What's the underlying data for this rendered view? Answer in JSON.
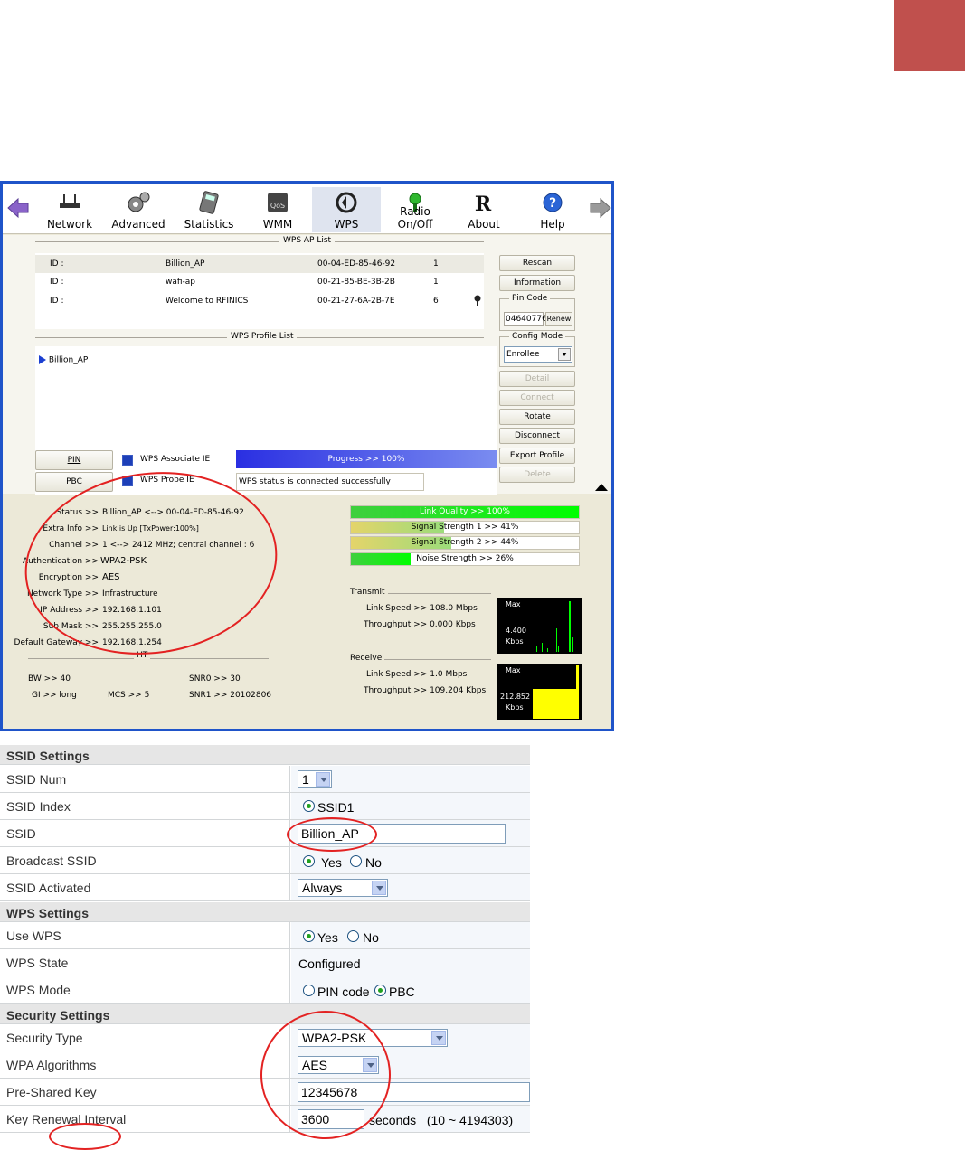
{
  "colors": {
    "corner_block": "#c0504d",
    "window_border": "#1f54c9",
    "annotation": "#e32222"
  },
  "toolbar": {
    "items": [
      {
        "label": "Network",
        "icon": "router-icon"
      },
      {
        "label": "Advanced",
        "icon": "gears-icon"
      },
      {
        "label": "Statistics",
        "icon": "calculator-icon"
      },
      {
        "label": "WMM",
        "icon": "qos-icon"
      },
      {
        "label": "WPS",
        "icon": "wps-icon"
      },
      {
        "label": "Radio On/Off",
        "icon": "radio-icon"
      },
      {
        "label": "About",
        "icon": "about-icon"
      },
      {
        "label": "Help",
        "icon": "help-icon"
      }
    ]
  },
  "wps_ap_list": {
    "title": "WPS AP List",
    "rows": [
      {
        "id_label": "ID :",
        "name": "Billion_AP",
        "mac": "00-04-ED-85-46-92",
        "channel": "1",
        "locked": false
      },
      {
        "id_label": "ID :",
        "name": "wafi-ap",
        "mac": "00-21-85-BE-3B-2B",
        "channel": "1",
        "locked": false
      },
      {
        "id_label": "ID :",
        "name": "Welcome to RFINICS",
        "mac": "00-21-27-6A-2B-7E",
        "channel": "6",
        "locked": true
      }
    ]
  },
  "wps_profile_list": {
    "title": "WPS Profile List",
    "items": [
      "Billion_AP"
    ]
  },
  "right_buttons": {
    "rescan": "Rescan",
    "information": "Information",
    "pin_code_title": "Pin Code",
    "pin_code": "04640776",
    "renew": "Renew",
    "config_mode_title": "Config Mode",
    "config_mode": "Enrollee",
    "detail": "Detail",
    "connect": "Connect",
    "rotate": "Rotate",
    "disconnect": "Disconnect",
    "export_profile": "Export Profile",
    "delete": "Delete"
  },
  "bottom_buttons": {
    "pin": "PIN",
    "pbc": "PBC",
    "associate_ie": "WPS Associate IE",
    "probe_ie": "WPS Probe IE"
  },
  "progress": {
    "text": "Progress >> 100%",
    "value": 1.0
  },
  "wps_status": "WPS status is connected successfully",
  "status": {
    "status": {
      "k": "Status >>",
      "v": "Billion_AP <--> 00-04-ED-85-46-92"
    },
    "extra_info": {
      "k": "Extra Info >>",
      "v": "Link is Up [TxPower:100%]"
    },
    "channel": {
      "k": "Channel >>",
      "v": "1 <--> 2412 MHz; central channel : 6"
    },
    "authentication": {
      "k": "Authentication >>",
      "v": "WPA2-PSK"
    },
    "encryption": {
      "k": "Encryption >>",
      "v": "AES"
    },
    "network_type": {
      "k": "Network Type >>",
      "v": "Infrastructure"
    },
    "ip_address": {
      "k": "IP Address >>",
      "v": "192.168.1.101"
    },
    "sub_mask": {
      "k": "Sub Mask >>",
      "v": "255.255.255.0"
    },
    "gateway": {
      "k": "Default Gateway >>",
      "v": "192.168.1.254"
    }
  },
  "ht": {
    "title": "HT",
    "bw": "BW >> 40",
    "gi": "GI >> long",
    "mcs": "MCS >> 5",
    "snr0": "SNR0 >> 30",
    "snr1": "SNR1 >> 20102806"
  },
  "signal": {
    "link_quality": {
      "text": "Link Quality >> 100%",
      "value": 1.0
    },
    "strength1": {
      "text": "Signal Strength 1 >> 41%",
      "value": 0.41
    },
    "strength2": {
      "text": "Signal Strength 2 >> 44%",
      "value": 0.44
    },
    "noise": {
      "text": "Noise Strength >> 26%",
      "value": 0.26
    }
  },
  "transmit": {
    "title": "Transmit",
    "link_speed": "Link Speed >> 108.0 Mbps",
    "throughput": "Throughput >> 0.000 Kbps",
    "graph_max": "Max",
    "graph_value": "4.400",
    "graph_unit": "Kbps"
  },
  "receive": {
    "title": "Receive",
    "link_speed": "Link Speed >> 1.0 Mbps",
    "throughput": "Throughput >> 109.204 Kbps",
    "graph_max": "Max",
    "graph_value": "212.852",
    "graph_unit": "Kbps"
  },
  "router": {
    "ssid_settings": "SSID Settings",
    "ssid_num": {
      "label": "SSID Num",
      "value": "1"
    },
    "ssid_index": {
      "label": "SSID Index",
      "option": "SSID1"
    },
    "ssid": {
      "label": "SSID",
      "value": "Billion_AP"
    },
    "broadcast_ssid": {
      "label": "Broadcast SSID",
      "yes": "Yes",
      "no": "No"
    },
    "ssid_activated": {
      "label": "SSID Activated",
      "value": "Always"
    },
    "wps_settings": "WPS Settings",
    "use_wps": {
      "label": "Use WPS",
      "yes": "Yes",
      "no": "No"
    },
    "wps_state": {
      "label": "WPS State",
      "value": "Configured"
    },
    "wps_mode": {
      "label": "WPS Mode",
      "pin": "PIN code",
      "pbc": "PBC"
    },
    "security_settings": "Security Settings",
    "security_type": {
      "label": "Security Type",
      "value": "WPA2-PSK"
    },
    "wpa_algorithms": {
      "label": "WPA Algorithms",
      "value": "AES"
    },
    "psk": {
      "label": "Pre-Shared Key",
      "value": "12345678"
    },
    "key_renewal": {
      "label": "Key Renewal Interval",
      "value": "3600",
      "suffix": "seconds   (10 ~ 4194303)"
    }
  }
}
